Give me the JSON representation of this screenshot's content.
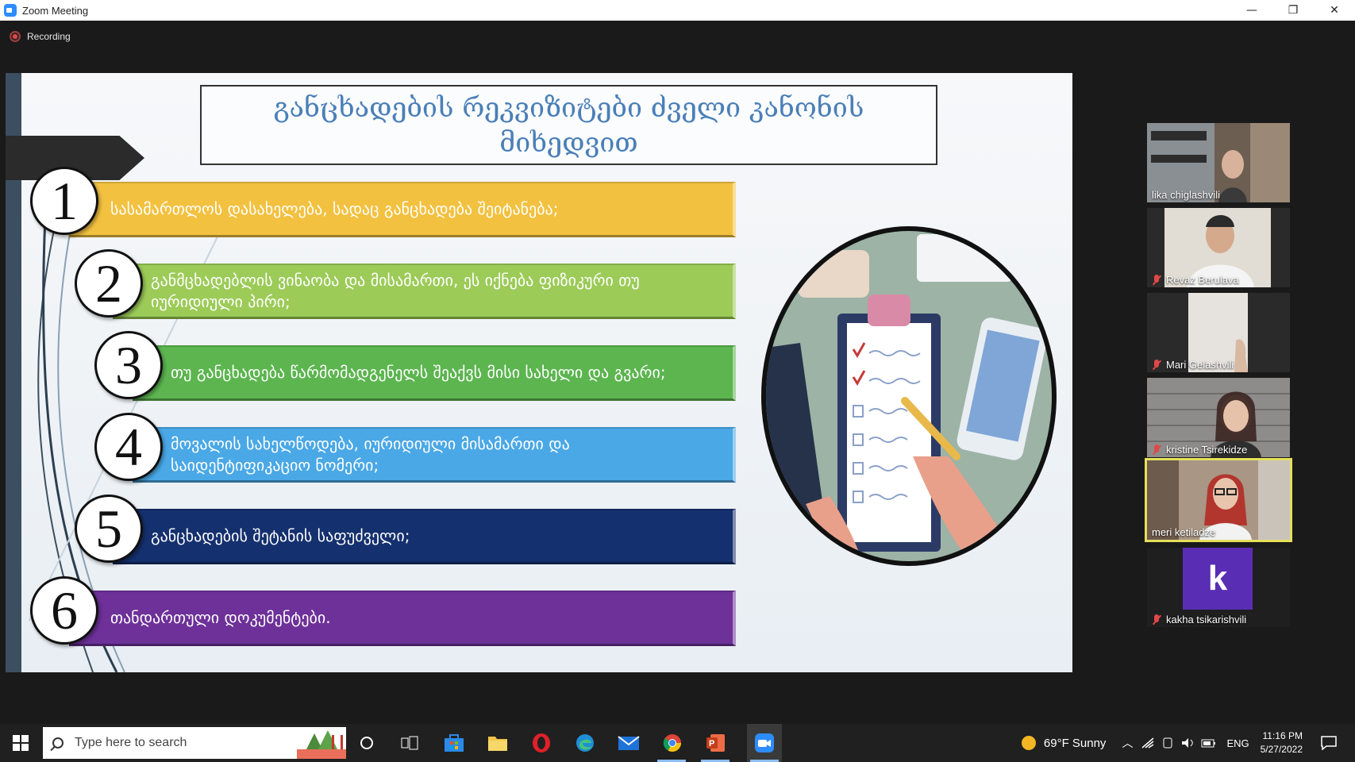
{
  "window": {
    "title": "Zoom Meeting",
    "controls": [
      "—",
      "❐",
      "✕"
    ]
  },
  "recording": {
    "label": "Recording"
  },
  "slide": {
    "title": "განცხადების რეკვიზიტები ძველი კანონის მიხედვით",
    "items": [
      {
        "number": "1",
        "text": "სასამართლოს დასახელება, სადაც განცხადება შეიტანება;",
        "color": "#f3c140"
      },
      {
        "number": "2",
        "text": "განმცხადებლის ვინაობა და მისამართი, ეს იქნება ფიზიკური თუ იურიდიული პირი;",
        "color": "#9ccb58"
      },
      {
        "number": "3",
        "text": "თუ განცხადება წარმომადგენელს შეაქვს მისი სახელი და გვარი;",
        "color": "#5cb54f"
      },
      {
        "number": "4",
        "text": "მოვალის სახელწოდება, იურიდიული მისამართი და საიდენტიფიკაციო ნომერი;",
        "color": "#4aa8e6"
      },
      {
        "number": "5",
        "text": "განცხადების შეტანის საფუძველი;",
        "color": "#15306e"
      },
      {
        "number": "6",
        "text": "თანდართული დოკუმენტები.",
        "color": "#6d3199"
      }
    ]
  },
  "participants": [
    {
      "name": "lika chiglashvili",
      "muted": false,
      "active": false,
      "avatar_letter": ""
    },
    {
      "name": "Revaz Berulava",
      "muted": true,
      "active": false,
      "avatar_letter": ""
    },
    {
      "name": "Mari Gelashvili",
      "muted": true,
      "active": false,
      "avatar_letter": ""
    },
    {
      "name": "kristine Tsirekidze",
      "muted": true,
      "active": false,
      "avatar_letter": ""
    },
    {
      "name": "meri ketiladze",
      "muted": false,
      "active": true,
      "avatar_letter": ""
    },
    {
      "name": "kakha tsikarishvili",
      "muted": true,
      "active": false,
      "avatar_letter": "k"
    }
  ],
  "taskbar": {
    "search_placeholder": "Type here to search",
    "weather": "69°F  Sunny",
    "language": "ENG",
    "time": "11:16 PM",
    "date": "5/27/2022",
    "apps": [
      "cortana-icon",
      "task-view-icon",
      "microsoft-store-icon",
      "file-explorer-icon",
      "opera-icon",
      "edge-icon",
      "mail-icon",
      "chrome-icon",
      "powerpoint-icon",
      "zoom-icon"
    ]
  }
}
